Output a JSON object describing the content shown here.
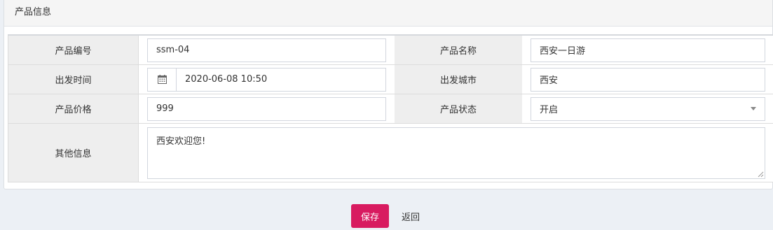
{
  "panel": {
    "title": "产品信息"
  },
  "form": {
    "product_no": {
      "label": "产品编号",
      "value": "ssm-04"
    },
    "product_name": {
      "label": "产品名称",
      "value": "西安一日游"
    },
    "depart_time": {
      "label": "出发时间",
      "value": "2020-06-08 10:50",
      "icon": "calendar-icon"
    },
    "depart_city": {
      "label": "出发城市",
      "value": "西安"
    },
    "price": {
      "label": "产品价格",
      "value": "999"
    },
    "status": {
      "label": "产品状态",
      "value": "开启"
    },
    "other_info": {
      "label": "其他信息",
      "value": "西安欢迎您!"
    }
  },
  "actions": {
    "save_label": "保存",
    "back_label": "返回"
  },
  "colors": {
    "save_button": "#d81b60",
    "label_bg": "#eeeeee",
    "page_bg": "#ecf0f5"
  }
}
